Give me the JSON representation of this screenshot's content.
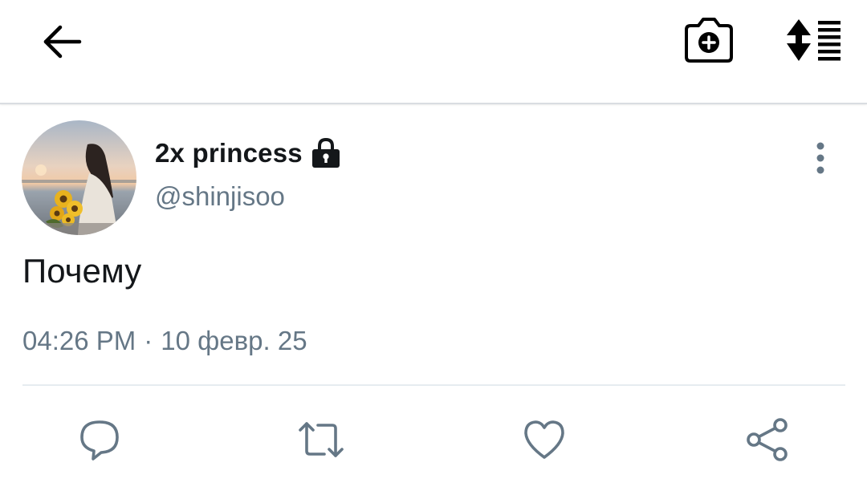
{
  "toolbar": {
    "back_icon": "arrow-left-icon",
    "camera_icon": "camera-add-icon",
    "sort_icon": "sort-lines-icon"
  },
  "tweet": {
    "author": {
      "display_name": "2x princess",
      "handle": "@shinjisoo",
      "protected_icon": "lock-icon",
      "avatar_icon": "avatar-photo"
    },
    "more_icon": "more-vertical-icon",
    "text": "Почему",
    "time": "04:26 PM",
    "separator": "·",
    "date": "10 февр. 25"
  },
  "actions": [
    {
      "name": "reply",
      "icon": "speech-bubble-icon"
    },
    {
      "name": "retweet",
      "icon": "retweet-icon"
    },
    {
      "name": "like",
      "icon": "heart-icon"
    },
    {
      "name": "share",
      "icon": "share-icon"
    }
  ],
  "colors": {
    "text_primary": "#14171a",
    "text_secondary": "#657786",
    "icon_secondary": "#657786"
  }
}
